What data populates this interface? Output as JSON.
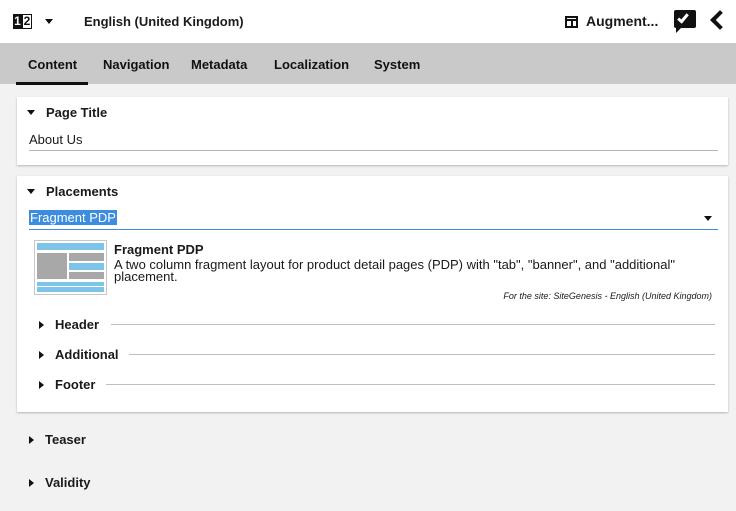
{
  "topbar": {
    "lang_icon_left": "1",
    "lang_icon_right": "2",
    "language": "English (United Kingdom)",
    "augment_label": "Augment..."
  },
  "tabs": [
    "Content",
    "Navigation",
    "Metadata",
    "Localization",
    "System"
  ],
  "active_tab": "Content",
  "page_title_section": {
    "header": "Page Title",
    "value": "About Us"
  },
  "placements_section": {
    "header": "Placements",
    "selected": "Fragment PDP",
    "layout_name": "Fragment PDP",
    "layout_description": "A two column fragment layout for product detail pages (PDP) with \"tab\", \"banner\", and \"additional\" placement.",
    "site_note": "For the site: SiteGenesis - English (United Kingdom)",
    "sub_sections": [
      "Header",
      "Additional",
      "Footer"
    ]
  },
  "collapsed_sections": [
    "Teaser",
    "Validity"
  ],
  "colors": {
    "accent": "#3c8dde",
    "tab_bar": "#c9c9c9",
    "thumb_blue": "#7cc4e8",
    "thumb_gray": "#a8a8a8"
  }
}
